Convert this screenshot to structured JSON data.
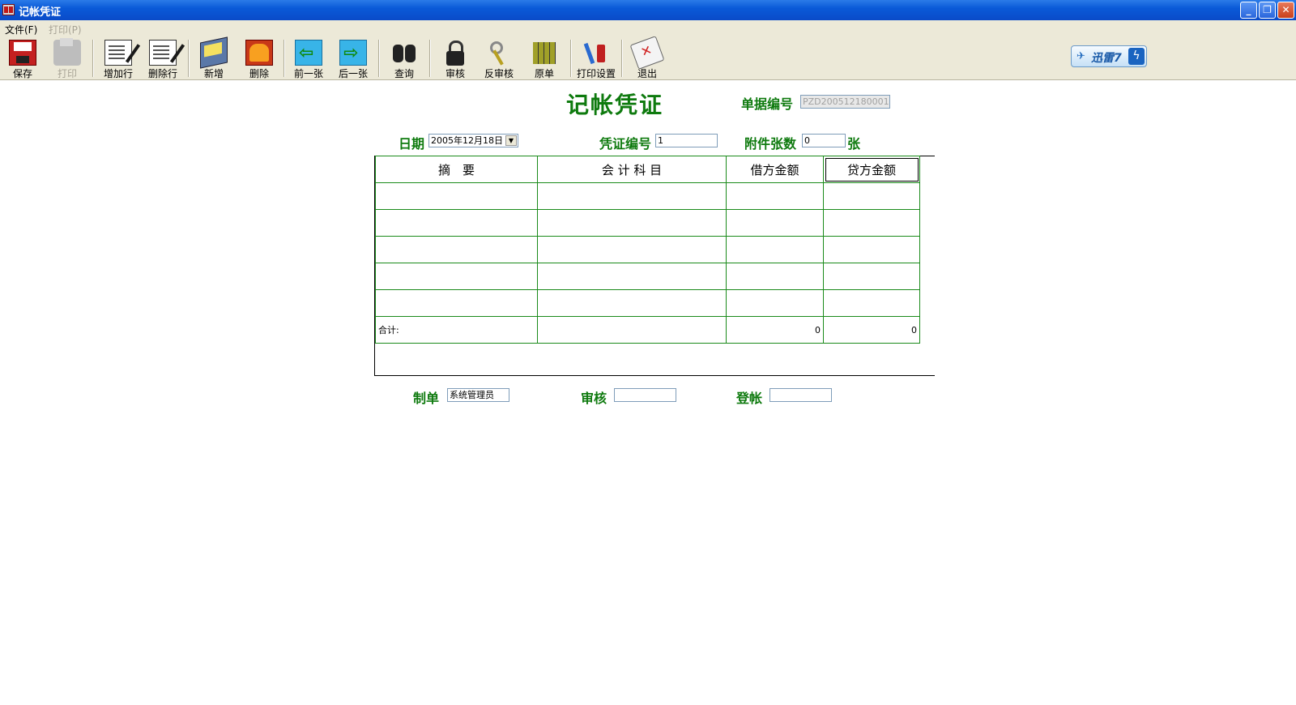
{
  "window": {
    "title": "记帐凭证",
    "controls": [
      "_",
      "❐",
      "✕"
    ]
  },
  "menu": {
    "file": "文件(F)",
    "print": "打印(P)"
  },
  "toolbar": {
    "save": "保存",
    "print": "打印",
    "add_row": "增加行",
    "delete_row": "删除行",
    "new": "新增",
    "delete": "删除",
    "prev": "前一张",
    "next": "后一张",
    "query": "查询",
    "audit": "审核",
    "unaudit": "反审核",
    "original": "原单",
    "print_setup": "打印设置",
    "exit": "退出"
  },
  "badge": {
    "brand": "迅雷7",
    "bolt": "ϟ"
  },
  "form": {
    "title": "记帐凭证",
    "doc_no_label": "单据编号",
    "doc_no_value": "PZD200512180001",
    "date_label": "日期",
    "date_value": "2005年12月18日",
    "voucher_no_label": "凭证编号",
    "voucher_no_value": "1",
    "attach_label": "附件张数",
    "attach_value": "0",
    "attach_unit": "张"
  },
  "grid": {
    "headers": [
      "摘　要",
      "会 计 科 目",
      "借方金额",
      "贷方金额"
    ],
    "total_label": "合计:",
    "debit_total": "0",
    "credit_total": "0"
  },
  "footer": {
    "maker_label": "制单",
    "maker_value": "系统管理员",
    "auditor_label": "审核",
    "auditor_value": "",
    "poster_label": "登帐",
    "poster_value": ""
  },
  "colors": {
    "label_green": "#0e7a0e",
    "grid_green": "#1a8a1a",
    "titlebar_blue": "#0a5ad8"
  }
}
